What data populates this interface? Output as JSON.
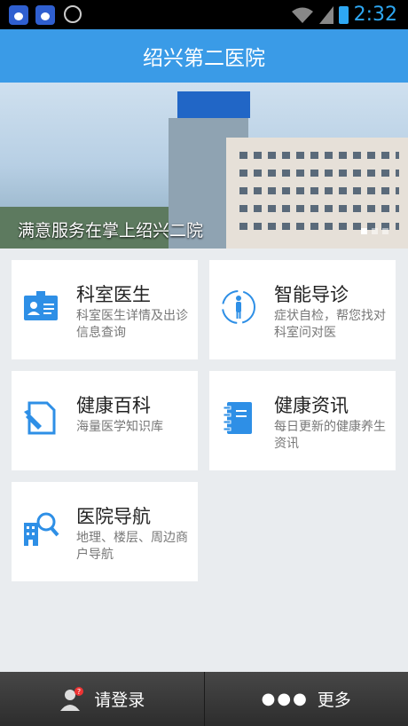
{
  "status_bar": {
    "time": "2:32"
  },
  "header": {
    "title": "绍兴第二医院"
  },
  "banner": {
    "caption": "满意服务在掌上绍兴二院"
  },
  "cards": [
    {
      "title": "科室医生",
      "desc": "科室医生详情及出诊信息查询",
      "icon": "doctor-id-card-icon"
    },
    {
      "title": "智能导诊",
      "desc": "症状自检，帮您找对科室问对医",
      "icon": "human-body-icon"
    },
    {
      "title": "健康百科",
      "desc": "海量医学知识库",
      "icon": "pencil-document-icon"
    },
    {
      "title": "健康资讯",
      "desc": "每日更新的健康养生资讯",
      "icon": "notebook-icon"
    },
    {
      "title": "医院导航",
      "desc": "地理、楼层、周边商户导航",
      "icon": "building-search-icon"
    }
  ],
  "bottom_bar": {
    "login": "请登录",
    "more": "更多"
  },
  "colors": {
    "accent": "#3a9be7"
  }
}
